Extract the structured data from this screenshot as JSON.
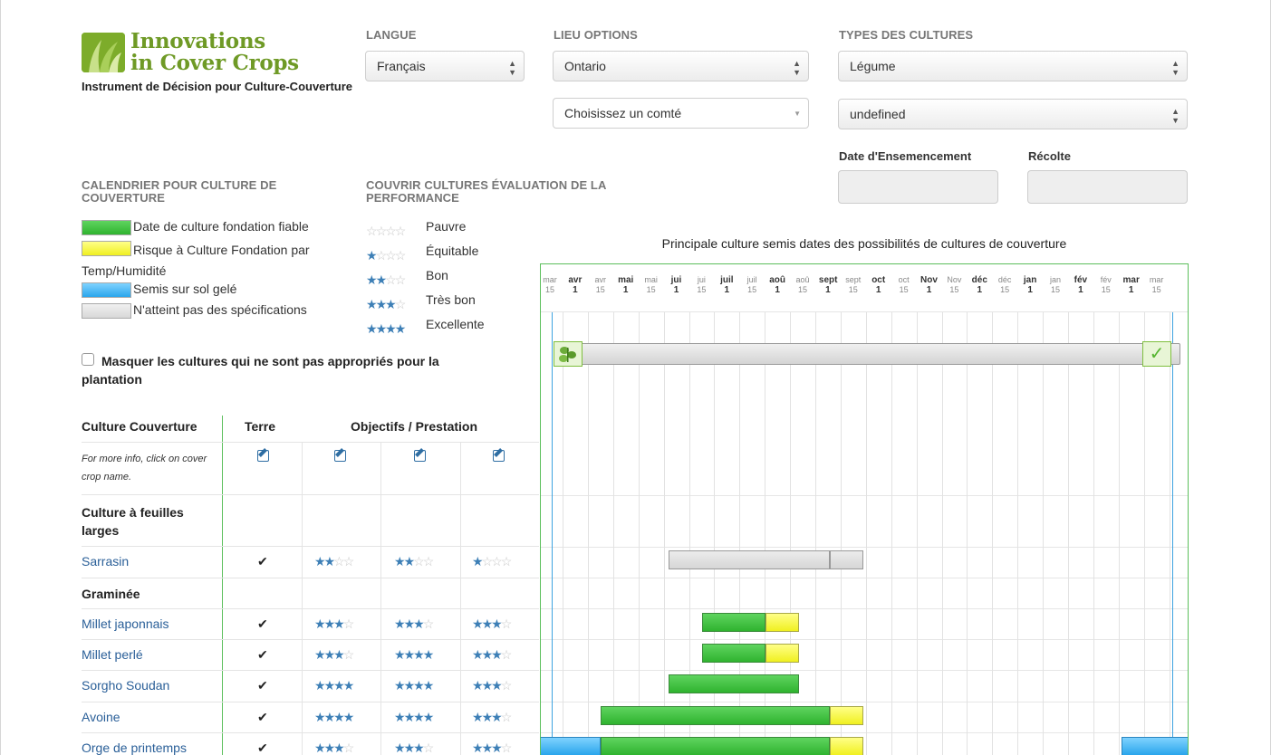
{
  "app": {
    "logo_line1": "Innovations",
    "logo_line2": "in Cover Crops",
    "tagline": "Instrument de Décision pour Culture-Couverture"
  },
  "controls": {
    "langue_label": "LANGUE",
    "langue_value": "Français",
    "lieu_label": "LIEU OPTIONS",
    "lieu_value": "Ontario",
    "county_value": "Choisissez un comté",
    "types_label": "TYPES DES CULTURES",
    "types_value": "Légume",
    "types_value2": "undefined",
    "seed_date_label": "Date d'Ensemencement",
    "harvest_label": "Récolte"
  },
  "calendar_legend": {
    "title": "CALENDRIER POUR CULTURE DE COUVERTURE",
    "items": [
      {
        "label": "Date de culture fondation fiable",
        "color": "#3cbf3c"
      },
      {
        "label": "Risque à Culture Fondation par Temp/Humidité",
        "color": "#ffff55"
      },
      {
        "label": "Semis sur sol gelé",
        "color": "#3aaff0"
      },
      {
        "label": "N'atteint pas des spécifications",
        "color": "#e0e0e0"
      }
    ]
  },
  "performance_legend": {
    "title": "COUVRIR CULTURES ÉVALUATION DE LA PERFORMANCE",
    "items": [
      {
        "label": "Pauvre",
        "stars": 0
      },
      {
        "label": "Équitable",
        "stars": 1
      },
      {
        "label": "Bon",
        "stars": 2
      },
      {
        "label": "Très bon",
        "stars": 3
      },
      {
        "label": "Excellente",
        "stars": 4
      }
    ]
  },
  "hide_checkbox_label": "Masquer les cultures qui ne sont pas appropriés pour la plantation",
  "table": {
    "col_crop": "Culture Couverture",
    "col_terre": "Terre",
    "col_objectifs": "Objectifs / Prestation",
    "note": "For more info, click on cover crop name.",
    "categories": [
      "Culture à feuilles larges",
      "Graminée"
    ],
    "rows": [
      {
        "name": "Sarrasin",
        "check": "✔",
        "stars": [
          2,
          2,
          1
        ]
      },
      {
        "name": "Millet japonnais",
        "check": "✔",
        "stars": [
          3,
          3,
          3
        ]
      },
      {
        "name": "Millet perlé",
        "check": "✔",
        "stars": [
          3,
          4,
          3
        ]
      },
      {
        "name": "Sorgho Soudan",
        "check": "✔",
        "stars": [
          4,
          4,
          3
        ]
      },
      {
        "name": "Avoine",
        "check": "✔",
        "stars": [
          4,
          4,
          3
        ]
      },
      {
        "name": "Orge de printemps",
        "check": "✔",
        "stars": [
          3,
          3,
          3
        ]
      }
    ]
  },
  "chart": {
    "title": "Principale culture semis dates des possibilités de cultures de couverture",
    "ticks": [
      {
        "m": "mar",
        "d": "15",
        "big": false
      },
      {
        "m": "avr",
        "d": "1",
        "big": true
      },
      {
        "m": "avr",
        "d": "15",
        "big": false
      },
      {
        "m": "mai",
        "d": "1",
        "big": true
      },
      {
        "m": "mai",
        "d": "15",
        "big": false
      },
      {
        "m": "jui",
        "d": "1",
        "big": true
      },
      {
        "m": "jui",
        "d": "15",
        "big": false
      },
      {
        "m": "juil",
        "d": "1",
        "big": true
      },
      {
        "m": "juil",
        "d": "15",
        "big": false
      },
      {
        "m": "aoû",
        "d": "1",
        "big": true
      },
      {
        "m": "aoû",
        "d": "15",
        "big": false
      },
      {
        "m": "sept",
        "d": "1",
        "big": true
      },
      {
        "m": "sept",
        "d": "15",
        "big": false
      },
      {
        "m": "oct",
        "d": "1",
        "big": true
      },
      {
        "m": "oct",
        "d": "15",
        "big": false
      },
      {
        "m": "Nov",
        "d": "1",
        "big": true
      },
      {
        "m": "Nov",
        "d": "15",
        "big": false
      },
      {
        "m": "déc",
        "d": "1",
        "big": true
      },
      {
        "m": "déc",
        "d": "15",
        "big": false
      },
      {
        "m": "jan",
        "d": "1",
        "big": true
      },
      {
        "m": "jan",
        "d": "15",
        "big": false
      },
      {
        "m": "fév",
        "d": "1",
        "big": true
      },
      {
        "m": "fév",
        "d": "15",
        "big": false
      },
      {
        "m": "mar",
        "d": "1",
        "big": true
      },
      {
        "m": "mar",
        "d": "15",
        "big": false
      }
    ]
  }
}
